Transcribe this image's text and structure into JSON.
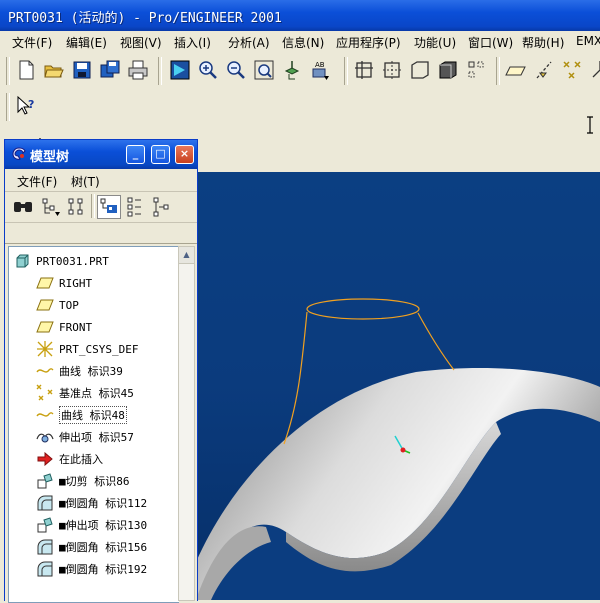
{
  "window": {
    "title": "PRT0031 (活动的) - Pro/ENGINEER 2001"
  },
  "menu": [
    "文件(F)",
    "编辑(E)",
    "视图(V)",
    "插入(I)",
    "分析(A)",
    "信息(N)",
    "应用程序(P)",
    "功能(U)",
    "窗口(W)",
    "帮助(H)",
    "EMX"
  ],
  "toolbar": {
    "buttons": [
      "new-icon",
      "open-icon",
      "save-icon",
      "save-copy-icon",
      "print-icon",
      "repaint-icon",
      "zoom-in-icon",
      "zoom-out-icon",
      "refit-icon",
      "orient-icon",
      "saved-views-icon",
      "datum-planes-icon",
      "datum-axes-icon",
      "datum-planes-display-icon",
      "shading-icon",
      "hidden-line-icon",
      "datum-plane-tool-icon",
      "datum-axis-tool-icon",
      "datum-point-tool-icon",
      "csys-tool-icon"
    ]
  },
  "context_help_icon": "context-help-icon",
  "model_tree": {
    "title": "模型树",
    "menu": [
      "文件(F)",
      "树(T)"
    ],
    "tools": [
      "find-icon",
      "settings-icon",
      "columns-icon",
      "show-icon",
      "expand-icon",
      "collapse-icon"
    ],
    "items": [
      {
        "label": "PRT0031.PRT",
        "icon": "part-icon",
        "selected": false
      },
      {
        "label": "RIGHT",
        "icon": "datum-plane-icon",
        "selected": false
      },
      {
        "label": "TOP",
        "icon": "datum-plane-icon",
        "selected": false
      },
      {
        "label": "FRONT",
        "icon": "datum-plane-icon",
        "selected": false
      },
      {
        "label": "PRT_CSYS_DEF",
        "icon": "csys-icon",
        "selected": false
      },
      {
        "label": "曲线 标识39",
        "icon": "curve-icon",
        "selected": false
      },
      {
        "label": "基准点 标识45",
        "icon": "datum-point-icon",
        "selected": false
      },
      {
        "label": "曲线 标识48",
        "icon": "curve-icon",
        "selected": true
      },
      {
        "label": "伸出项 标识57",
        "icon": "protrusion-icon",
        "selected": false
      },
      {
        "label": "在此插入",
        "icon": "insert-here-icon",
        "selected": false
      },
      {
        "label": "■切剪 标识86",
        "icon": "cut-icon",
        "selected": false
      },
      {
        "label": "■倒圆角 标识112",
        "icon": "round-icon",
        "selected": false
      },
      {
        "label": "■伸出项 标识130",
        "icon": "protrusion-icon",
        "selected": false
      },
      {
        "label": "■倒圆角 标识156",
        "icon": "round-icon",
        "selected": false
      },
      {
        "label": "■倒圆角 标识192",
        "icon": "round-icon",
        "selected": false
      }
    ]
  },
  "colors": {
    "viewport_bg": "#0b3d80",
    "curve": "#f0a020",
    "title_blue": "#0a4fd8"
  }
}
